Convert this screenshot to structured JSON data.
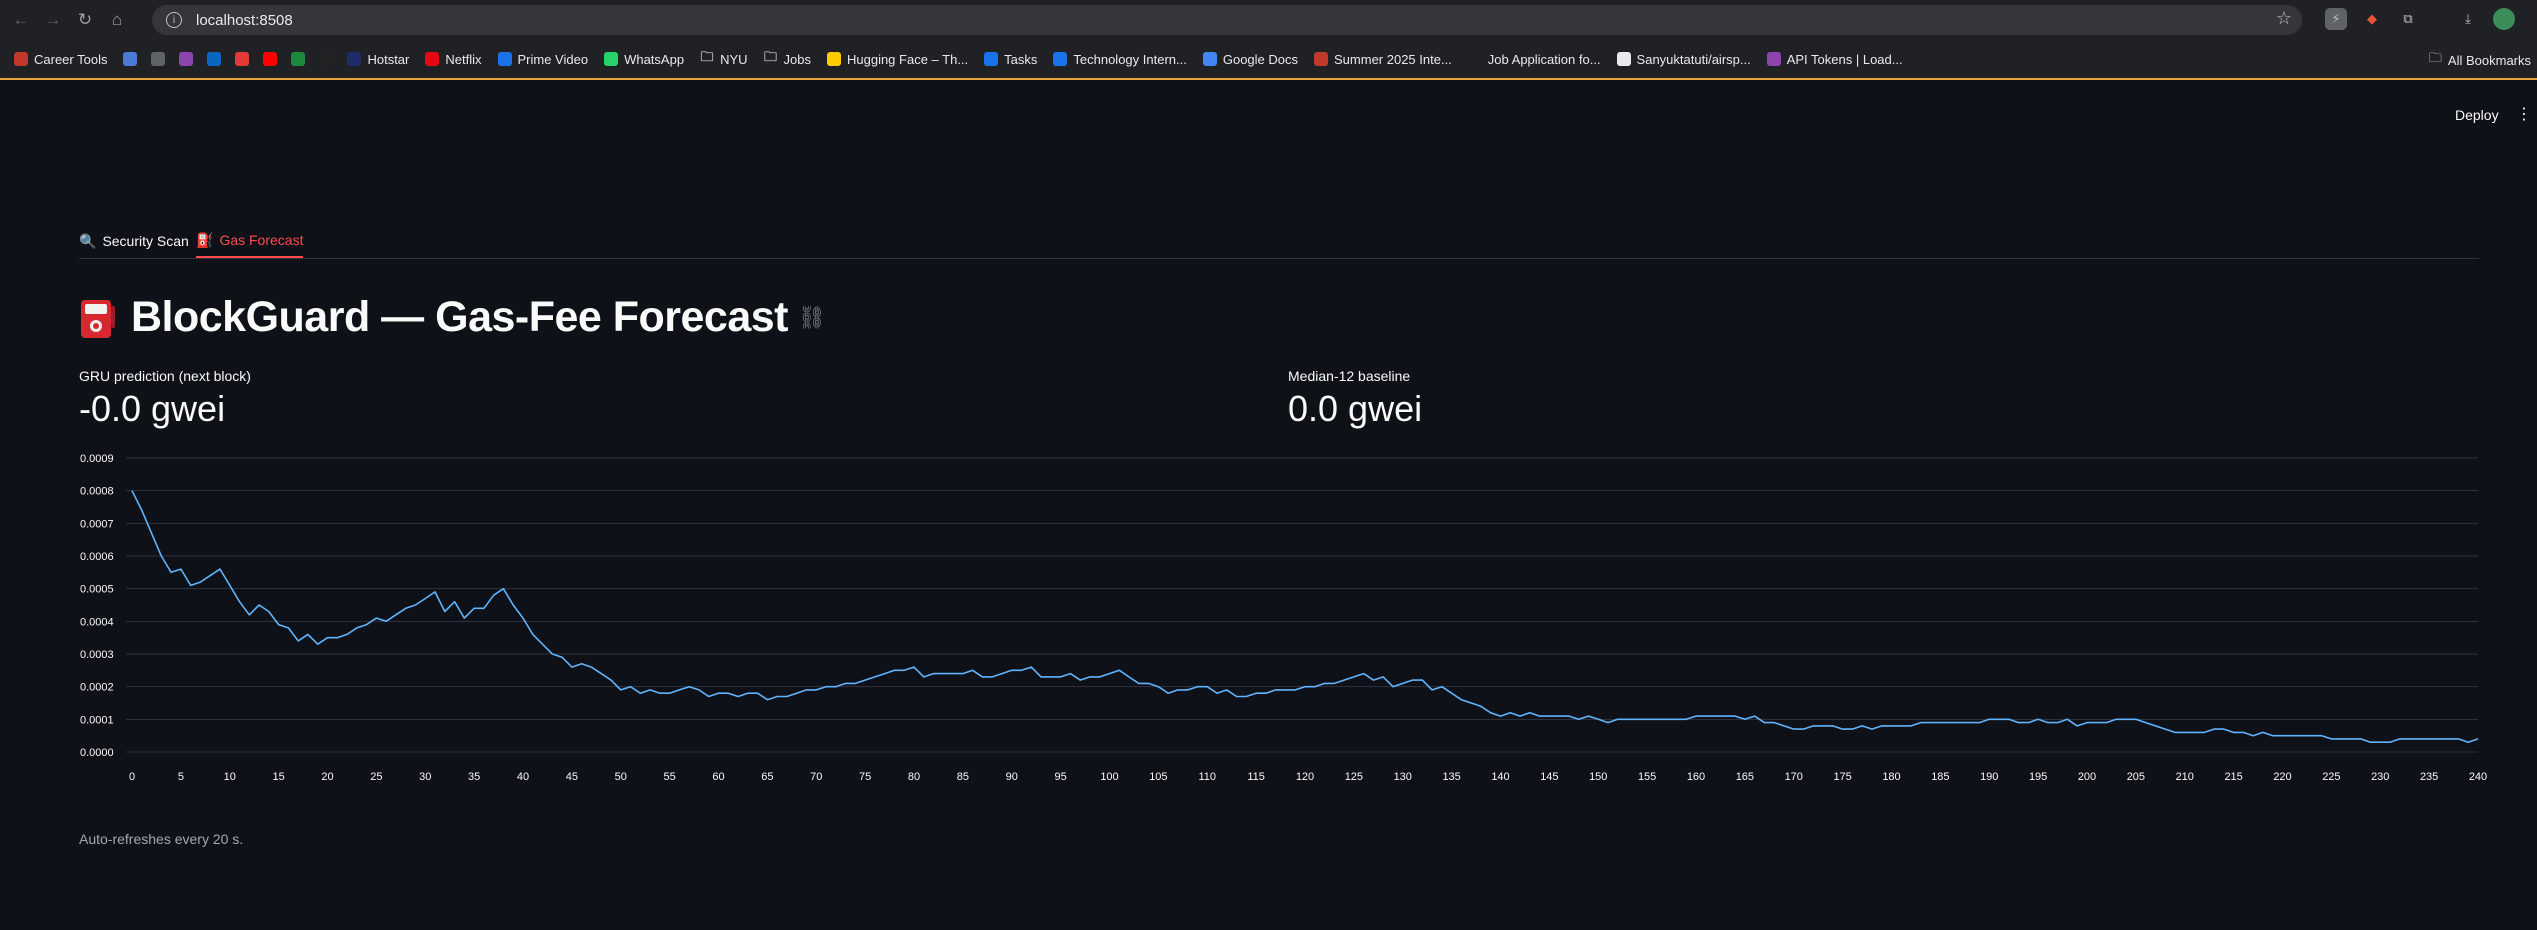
{
  "browser": {
    "url": "localhost:8508",
    "bookmarks": [
      {
        "label": "Career Tools",
        "color": "#c0392b",
        "emoji": "🧰"
      },
      {
        "label": "",
        "color": "#4a7bd6"
      },
      {
        "label": "",
        "color": "#5f6368"
      },
      {
        "label": "",
        "color": "#8e44ad"
      },
      {
        "label": "",
        "color": "#0a66c2"
      },
      {
        "label": "",
        "color": "#e53935"
      },
      {
        "label": "",
        "color": "#ff0000"
      },
      {
        "label": "",
        "color": "#1b8a3e"
      },
      {
        "label": "",
        "color": "#222"
      },
      {
        "label": "Hotstar",
        "color": "#1f2b6b"
      },
      {
        "label": "Netflix",
        "color": "#e50914"
      },
      {
        "label": "Prime Video",
        "color": "#1a73e8"
      },
      {
        "label": "WhatsApp",
        "color": "#25d366"
      },
      {
        "label": "NYU",
        "color": "#5f6368",
        "folder": true
      },
      {
        "label": "Jobs",
        "color": "#5f6368",
        "folder": true
      },
      {
        "label": "Hugging Face – Th...",
        "color": "#ffcc00"
      },
      {
        "label": "Tasks",
        "color": "#1a73e8"
      },
      {
        "label": "Technology Intern...",
        "color": "#1a73e8"
      },
      {
        "label": "Google Docs",
        "color": "#4285f4"
      },
      {
        "label": "Summer 2025 Inte...",
        "color": "#c0392b"
      },
      {
        "label": "Job Application fo...",
        "color": "#202124"
      },
      {
        "label": "Sanyuktatuti/airsp...",
        "color": "#e8eaed"
      },
      {
        "label": "API Tokens | Load...",
        "color": "#8e44ad"
      }
    ],
    "all_bookmarks": "All Bookmarks"
  },
  "app": {
    "deploy_label": "Deploy",
    "tabs": [
      {
        "label": "Security Scan",
        "emoji": "🔍"
      },
      {
        "label": "Gas Forecast",
        "emoji": "⛽"
      }
    ],
    "title": "BlockGuard — Gas-Fee Forecast",
    "metrics": [
      {
        "label": "GRU prediction (next block)",
        "value": "-0.0 gwei"
      },
      {
        "label": "Median-12 baseline",
        "value": "0.0 gwei"
      }
    ],
    "caption": "Auto-refreshes every 20 s."
  },
  "chart_data": {
    "type": "line",
    "line_color": "#60b4ff",
    "grid": true,
    "xlim": [
      0,
      240
    ],
    "ylim": [
      0,
      0.0009
    ],
    "yticks": [
      "0.0000",
      "0.0001",
      "0.0002",
      "0.0003",
      "0.0004",
      "0.0005",
      "0.0006",
      "0.0007",
      "0.0008",
      "0.0009"
    ],
    "xticks": [
      0,
      5,
      10,
      15,
      20,
      25,
      30,
      35,
      40,
      45,
      50,
      55,
      60,
      65,
      70,
      75,
      80,
      85,
      90,
      95,
      100,
      105,
      110,
      115,
      120,
      125,
      130,
      135,
      140,
      145,
      150,
      155,
      160,
      165,
      170,
      175,
      180,
      185,
      190,
      195,
      200,
      205,
      210,
      215,
      220,
      225,
      230,
      235,
      240
    ],
    "points": [
      [
        0,
        0.0008
      ],
      [
        1,
        0.00074
      ],
      [
        2,
        0.00067
      ],
      [
        3,
        0.0006
      ],
      [
        4,
        0.00055
      ],
      [
        5,
        0.00056
      ],
      [
        6,
        0.00051
      ],
      [
        7,
        0.00052
      ],
      [
        8,
        0.00054
      ],
      [
        9,
        0.00056
      ],
      [
        10,
        0.00051
      ],
      [
        11,
        0.00046
      ],
      [
        12,
        0.00042
      ],
      [
        13,
        0.00045
      ],
      [
        14,
        0.00043
      ],
      [
        15,
        0.00039
      ],
      [
        16,
        0.00038
      ],
      [
        17,
        0.00034
      ],
      [
        18,
        0.00036
      ],
      [
        19,
        0.00033
      ],
      [
        20,
        0.00035
      ],
      [
        21,
        0.00035
      ],
      [
        22,
        0.00036
      ],
      [
        23,
        0.00038
      ],
      [
        24,
        0.00039
      ],
      [
        25,
        0.00041
      ],
      [
        26,
        0.0004
      ],
      [
        27,
        0.00042
      ],
      [
        28,
        0.00044
      ],
      [
        29,
        0.00045
      ],
      [
        30,
        0.00047
      ],
      [
        31,
        0.00049
      ],
      [
        32,
        0.00043
      ],
      [
        33,
        0.00046
      ],
      [
        34,
        0.00041
      ],
      [
        35,
        0.00044
      ],
      [
        36,
        0.00044
      ],
      [
        37,
        0.00048
      ],
      [
        38,
        0.0005
      ],
      [
        39,
        0.00045
      ],
      [
        40,
        0.00041
      ],
      [
        41,
        0.00036
      ],
      [
        42,
        0.00033
      ],
      [
        43,
        0.0003
      ],
      [
        44,
        0.00029
      ],
      [
        45,
        0.00026
      ],
      [
        46,
        0.00027
      ],
      [
        47,
        0.00026
      ],
      [
        48,
        0.00024
      ],
      [
        49,
        0.00022
      ],
      [
        50,
        0.00019
      ],
      [
        51,
        0.0002
      ],
      [
        52,
        0.00018
      ],
      [
        53,
        0.00019
      ],
      [
        54,
        0.00018
      ],
      [
        55,
        0.00018
      ],
      [
        56,
        0.00019
      ],
      [
        57,
        0.0002
      ],
      [
        58,
        0.00019
      ],
      [
        59,
        0.00017
      ],
      [
        60,
        0.00018
      ],
      [
        61,
        0.00018
      ],
      [
        62,
        0.00017
      ],
      [
        63,
        0.00018
      ],
      [
        64,
        0.00018
      ],
      [
        65,
        0.00016
      ],
      [
        66,
        0.00017
      ],
      [
        67,
        0.00017
      ],
      [
        68,
        0.00018
      ],
      [
        69,
        0.00019
      ],
      [
        70,
        0.00019
      ],
      [
        71,
        0.0002
      ],
      [
        72,
        0.0002
      ],
      [
        73,
        0.00021
      ],
      [
        74,
        0.00021
      ],
      [
        75,
        0.00022
      ],
      [
        76,
        0.00023
      ],
      [
        77,
        0.00024
      ],
      [
        78,
        0.00025
      ],
      [
        79,
        0.00025
      ],
      [
        80,
        0.00026
      ],
      [
        81,
        0.00023
      ],
      [
        82,
        0.00024
      ],
      [
        83,
        0.00024
      ],
      [
        84,
        0.00024
      ],
      [
        85,
        0.00024
      ],
      [
        86,
        0.00025
      ],
      [
        87,
        0.00023
      ],
      [
        88,
        0.00023
      ],
      [
        89,
        0.00024
      ],
      [
        90,
        0.00025
      ],
      [
        91,
        0.00025
      ],
      [
        92,
        0.00026
      ],
      [
        93,
        0.00023
      ],
      [
        94,
        0.00023
      ],
      [
        95,
        0.00023
      ],
      [
        96,
        0.00024
      ],
      [
        97,
        0.00022
      ],
      [
        98,
        0.00023
      ],
      [
        99,
        0.00023
      ],
      [
        100,
        0.00024
      ],
      [
        101,
        0.00025
      ],
      [
        102,
        0.00023
      ],
      [
        103,
        0.00021
      ],
      [
        104,
        0.00021
      ],
      [
        105,
        0.0002
      ],
      [
        106,
        0.00018
      ],
      [
        107,
        0.00019
      ],
      [
        108,
        0.00019
      ],
      [
        109,
        0.0002
      ],
      [
        110,
        0.0002
      ],
      [
        111,
        0.00018
      ],
      [
        112,
        0.00019
      ],
      [
        113,
        0.00017
      ],
      [
        114,
        0.00017
      ],
      [
        115,
        0.00018
      ],
      [
        116,
        0.00018
      ],
      [
        117,
        0.00019
      ],
      [
        118,
        0.00019
      ],
      [
        119,
        0.00019
      ],
      [
        120,
        0.0002
      ],
      [
        121,
        0.0002
      ],
      [
        122,
        0.00021
      ],
      [
        123,
        0.00021
      ],
      [
        124,
        0.00022
      ],
      [
        125,
        0.00023
      ],
      [
        126,
        0.00024
      ],
      [
        127,
        0.00022
      ],
      [
        128,
        0.00023
      ],
      [
        129,
        0.0002
      ],
      [
        130,
        0.00021
      ],
      [
        131,
        0.00022
      ],
      [
        132,
        0.00022
      ],
      [
        133,
        0.00019
      ],
      [
        134,
        0.0002
      ],
      [
        135,
        0.00018
      ],
      [
        136,
        0.00016
      ],
      [
        137,
        0.00015
      ],
      [
        138,
        0.00014
      ],
      [
        139,
        0.00012
      ],
      [
        140,
        0.00011
      ],
      [
        141,
        0.00012
      ],
      [
        142,
        0.00011
      ],
      [
        143,
        0.00012
      ],
      [
        144,
        0.00011
      ],
      [
        145,
        0.00011
      ],
      [
        146,
        0.00011
      ],
      [
        147,
        0.00011
      ],
      [
        148,
        0.0001
      ],
      [
        149,
        0.00011
      ],
      [
        150,
        0.0001
      ],
      [
        151,
        9e-05
      ],
      [
        152,
        0.0001
      ],
      [
        153,
        0.0001
      ],
      [
        154,
        0.0001
      ],
      [
        155,
        0.0001
      ],
      [
        156,
        0.0001
      ],
      [
        157,
        0.0001
      ],
      [
        158,
        0.0001
      ],
      [
        159,
        0.0001
      ],
      [
        160,
        0.00011
      ],
      [
        161,
        0.00011
      ],
      [
        162,
        0.00011
      ],
      [
        163,
        0.00011
      ],
      [
        164,
        0.00011
      ],
      [
        165,
        0.0001
      ],
      [
        166,
        0.00011
      ],
      [
        167,
        9e-05
      ],
      [
        168,
        9e-05
      ],
      [
        169,
        8e-05
      ],
      [
        170,
        7e-05
      ],
      [
        171,
        7e-05
      ],
      [
        172,
        8e-05
      ],
      [
        173,
        8e-05
      ],
      [
        174,
        8e-05
      ],
      [
        175,
        7e-05
      ],
      [
        176,
        7e-05
      ],
      [
        177,
        8e-05
      ],
      [
        178,
        7e-05
      ],
      [
        179,
        8e-05
      ],
      [
        180,
        8e-05
      ],
      [
        181,
        8e-05
      ],
      [
        182,
        8e-05
      ],
      [
        183,
        9e-05
      ],
      [
        184,
        9e-05
      ],
      [
        185,
        9e-05
      ],
      [
        186,
        9e-05
      ],
      [
        187,
        9e-05
      ],
      [
        188,
        9e-05
      ],
      [
        189,
        9e-05
      ],
      [
        190,
        0.0001
      ],
      [
        191,
        0.0001
      ],
      [
        192,
        0.0001
      ],
      [
        193,
        9e-05
      ],
      [
        194,
        9e-05
      ],
      [
        195,
        0.0001
      ],
      [
        196,
        9e-05
      ],
      [
        197,
        9e-05
      ],
      [
        198,
        0.0001
      ],
      [
        199,
        8e-05
      ],
      [
        200,
        9e-05
      ],
      [
        201,
        9e-05
      ],
      [
        202,
        9e-05
      ],
      [
        203,
        0.0001
      ],
      [
        204,
        0.0001
      ],
      [
        205,
        0.0001
      ],
      [
        206,
        9e-05
      ],
      [
        207,
        8e-05
      ],
      [
        208,
        7e-05
      ],
      [
        209,
        6e-05
      ],
      [
        210,
        6e-05
      ],
      [
        211,
        6e-05
      ],
      [
        212,
        6e-05
      ],
      [
        213,
        7e-05
      ],
      [
        214,
        7e-05
      ],
      [
        215,
        6e-05
      ],
      [
        216,
        6e-05
      ],
      [
        217,
        5e-05
      ],
      [
        218,
        6e-05
      ],
      [
        219,
        5e-05
      ],
      [
        220,
        5e-05
      ],
      [
        221,
        5e-05
      ],
      [
        222,
        5e-05
      ],
      [
        223,
        5e-05
      ],
      [
        224,
        5e-05
      ],
      [
        225,
        4e-05
      ],
      [
        226,
        4e-05
      ],
      [
        227,
        4e-05
      ],
      [
        228,
        4e-05
      ],
      [
        229,
        3e-05
      ],
      [
        230,
        3e-05
      ],
      [
        231,
        3e-05
      ],
      [
        232,
        4e-05
      ],
      [
        233,
        4e-05
      ],
      [
        234,
        4e-05
      ],
      [
        235,
        4e-05
      ],
      [
        236,
        4e-05
      ],
      [
        237,
        4e-05
      ],
      [
        238,
        4e-05
      ],
      [
        239,
        3e-05
      ],
      [
        240,
        4e-05
      ]
    ]
  }
}
